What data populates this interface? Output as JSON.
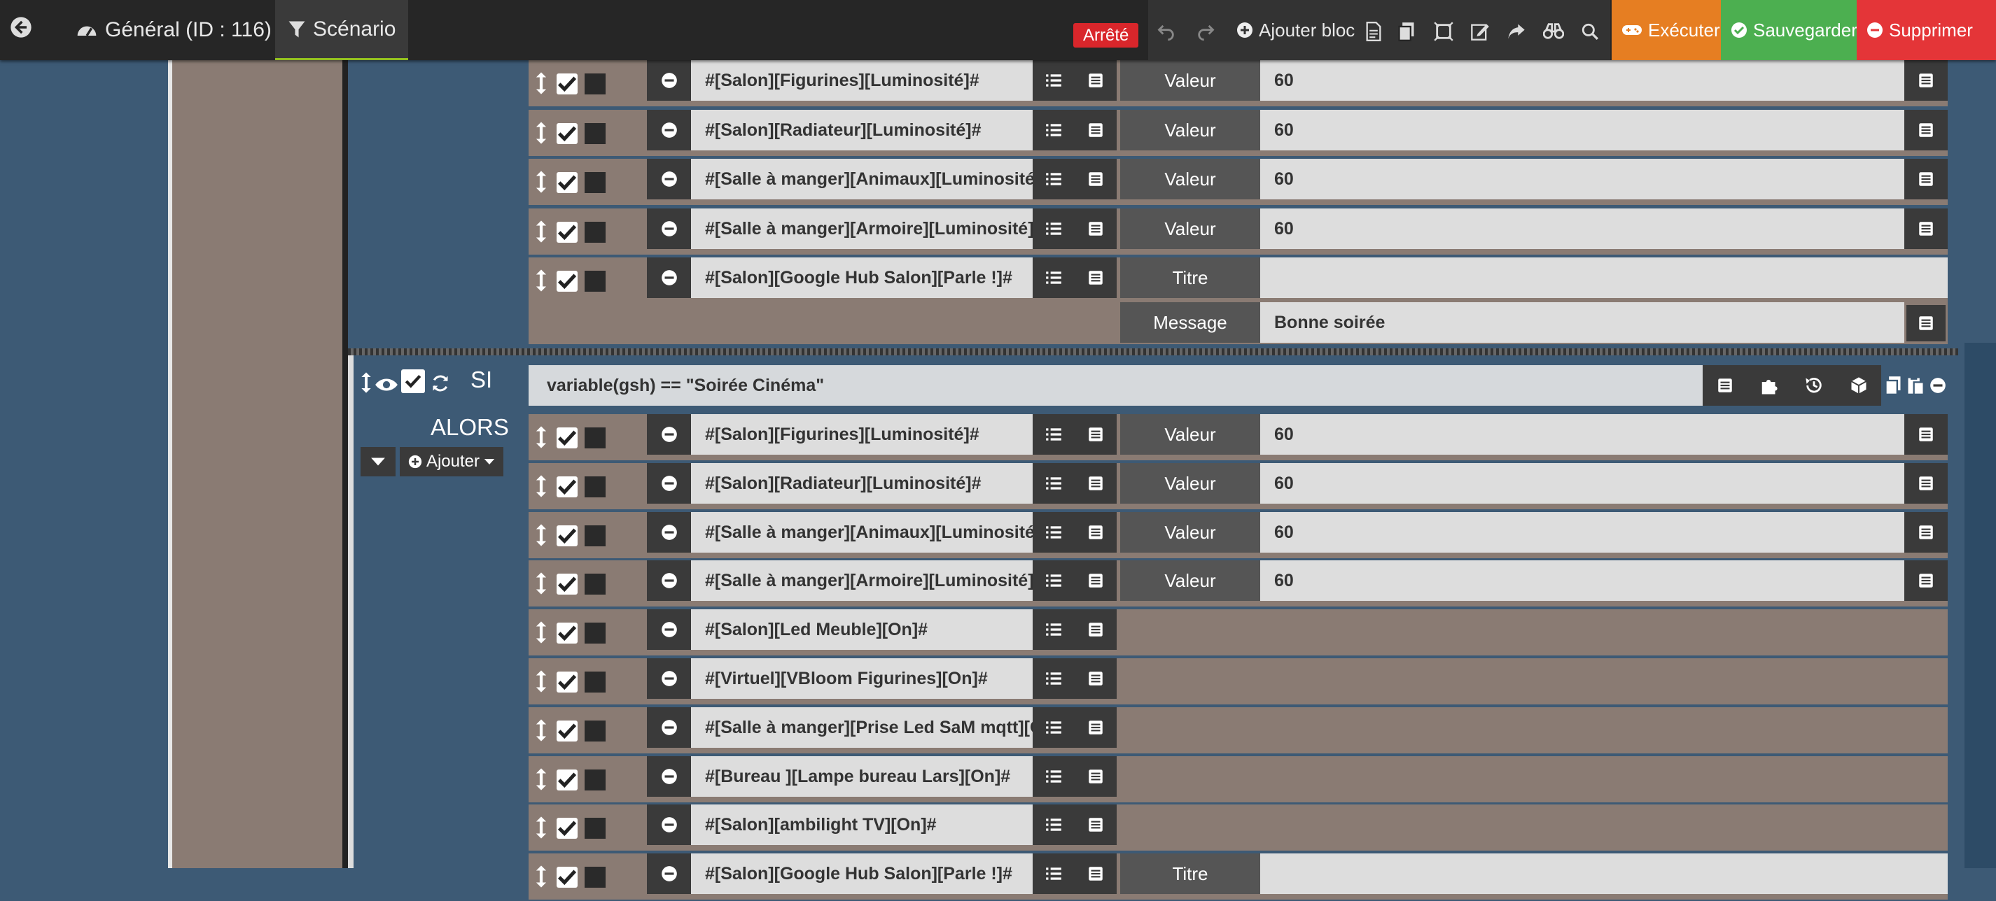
{
  "topbar": {
    "general_tab": "Général (ID : 116)",
    "scenario_tab": "Scénario",
    "state": "Arrêté",
    "add_block": "Ajouter bloc",
    "execute": "Exécuter",
    "save": "Sauvegarder",
    "delete": "Supprimer"
  },
  "colors": {
    "accent_execute": "#e67e22",
    "accent_save": "#4caf50",
    "accent_delete": "#e43538",
    "state_badge": "#d9262b",
    "background": "#3d5a75"
  },
  "block1": {
    "rows": [
      {
        "cmd": "#[Salon][Figurines][Luminosité]#",
        "label": "Valeur",
        "value": "60"
      },
      {
        "cmd": "#[Salon][Radiateur][Luminosité]#",
        "label": "Valeur",
        "value": "60"
      },
      {
        "cmd": "#[Salle à manger][Animaux][Luminosité]#",
        "label": "Valeur",
        "value": "60"
      },
      {
        "cmd": "#[Salle à manger][Armoire][Luminosité]#",
        "label": "Valeur",
        "value": "60"
      },
      {
        "cmd": "#[Salon][Google Hub Salon][Parle !]#",
        "label": "Titre",
        "value": ""
      }
    ],
    "message_label": "Message",
    "message_value": "Bonne soirée"
  },
  "block2": {
    "si_label": "SI",
    "condition": "variable(gsh) == \"Soirée Cinéma\"",
    "alors_label": "ALORS",
    "add_label": "Ajouter",
    "rows": [
      {
        "cmd": "#[Salon][Figurines][Luminosité]#",
        "label": "Valeur",
        "value": "60"
      },
      {
        "cmd": "#[Salon][Radiateur][Luminosité]#",
        "label": "Valeur",
        "value": "60"
      },
      {
        "cmd": "#[Salle à manger][Animaux][Luminosité]#",
        "label": "Valeur",
        "value": "60"
      },
      {
        "cmd": "#[Salle à manger][Armoire][Luminosité]#",
        "label": "Valeur",
        "value": "60"
      },
      {
        "cmd": "#[Salon][Led  Meuble][On]#"
      },
      {
        "cmd": "#[Virtuel][VBloom Figurines][On]#"
      },
      {
        "cmd": "#[Salle à manger][Prise Led SaM mqtt][On"
      },
      {
        "cmd": "#[Bureau ][Lampe bureau Lars][On]#"
      },
      {
        "cmd": "#[Salon][ambilight TV][On]#"
      },
      {
        "cmd": "#[Salon][Google Hub Salon][Parle !]#",
        "label": "Titre",
        "value": ""
      }
    ]
  }
}
